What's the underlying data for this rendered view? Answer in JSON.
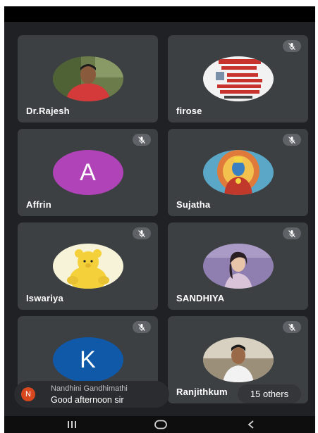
{
  "participants": [
    {
      "name": "Dr.Rajesh",
      "muted": false,
      "avatar": "photo-man-red-shirt"
    },
    {
      "name": "firose",
      "muted": true,
      "avatar": "photo-red-text-poster"
    },
    {
      "name": "Affrin",
      "muted": true,
      "avatar": "letter",
      "initial": "A",
      "color": "#b043b7"
    },
    {
      "name": "Sujatha",
      "muted": true,
      "avatar": "photo-deity"
    },
    {
      "name": "Iswariya",
      "muted": true,
      "avatar": "photo-yellow-teddy"
    },
    {
      "name": "SANDHIYA",
      "muted": true,
      "avatar": "photo-woman-portrait"
    },
    {
      "name": "",
      "muted": true,
      "avatar": "letter",
      "initial": "K",
      "color": "#1059a9"
    },
    {
      "name": "Ranjithkum",
      "muted": true,
      "avatar": "photo-young-man"
    }
  ],
  "chat": {
    "initial": "N",
    "initial_color": "#d7481f",
    "sender": "Nandhini Gandhimathi",
    "message": "Good afternoon sir"
  },
  "others_label": "15 others",
  "nav": {
    "icons": [
      "recents-icon",
      "home-icon",
      "back-icon"
    ]
  }
}
